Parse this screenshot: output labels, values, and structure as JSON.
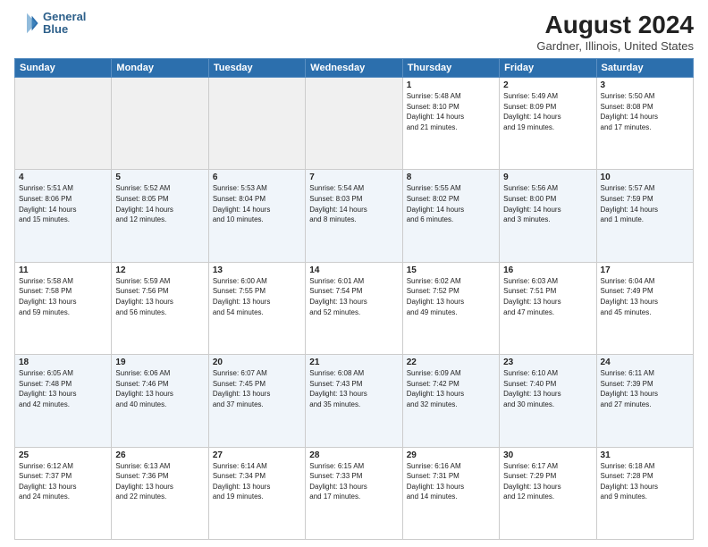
{
  "logo": {
    "line1": "General",
    "line2": "Blue"
  },
  "title": "August 2024",
  "subtitle": "Gardner, Illinois, United States",
  "days_of_week": [
    "Sunday",
    "Monday",
    "Tuesday",
    "Wednesday",
    "Thursday",
    "Friday",
    "Saturday"
  ],
  "weeks": [
    [
      {
        "day": "",
        "info": ""
      },
      {
        "day": "",
        "info": ""
      },
      {
        "day": "",
        "info": ""
      },
      {
        "day": "",
        "info": ""
      },
      {
        "day": "1",
        "info": "Sunrise: 5:48 AM\nSunset: 8:10 PM\nDaylight: 14 hours\nand 21 minutes."
      },
      {
        "day": "2",
        "info": "Sunrise: 5:49 AM\nSunset: 8:09 PM\nDaylight: 14 hours\nand 19 minutes."
      },
      {
        "day": "3",
        "info": "Sunrise: 5:50 AM\nSunset: 8:08 PM\nDaylight: 14 hours\nand 17 minutes."
      }
    ],
    [
      {
        "day": "4",
        "info": "Sunrise: 5:51 AM\nSunset: 8:06 PM\nDaylight: 14 hours\nand 15 minutes."
      },
      {
        "day": "5",
        "info": "Sunrise: 5:52 AM\nSunset: 8:05 PM\nDaylight: 14 hours\nand 12 minutes."
      },
      {
        "day": "6",
        "info": "Sunrise: 5:53 AM\nSunset: 8:04 PM\nDaylight: 14 hours\nand 10 minutes."
      },
      {
        "day": "7",
        "info": "Sunrise: 5:54 AM\nSunset: 8:03 PM\nDaylight: 14 hours\nand 8 minutes."
      },
      {
        "day": "8",
        "info": "Sunrise: 5:55 AM\nSunset: 8:02 PM\nDaylight: 14 hours\nand 6 minutes."
      },
      {
        "day": "9",
        "info": "Sunrise: 5:56 AM\nSunset: 8:00 PM\nDaylight: 14 hours\nand 3 minutes."
      },
      {
        "day": "10",
        "info": "Sunrise: 5:57 AM\nSunset: 7:59 PM\nDaylight: 14 hours\nand 1 minute."
      }
    ],
    [
      {
        "day": "11",
        "info": "Sunrise: 5:58 AM\nSunset: 7:58 PM\nDaylight: 13 hours\nand 59 minutes."
      },
      {
        "day": "12",
        "info": "Sunrise: 5:59 AM\nSunset: 7:56 PM\nDaylight: 13 hours\nand 56 minutes."
      },
      {
        "day": "13",
        "info": "Sunrise: 6:00 AM\nSunset: 7:55 PM\nDaylight: 13 hours\nand 54 minutes."
      },
      {
        "day": "14",
        "info": "Sunrise: 6:01 AM\nSunset: 7:54 PM\nDaylight: 13 hours\nand 52 minutes."
      },
      {
        "day": "15",
        "info": "Sunrise: 6:02 AM\nSunset: 7:52 PM\nDaylight: 13 hours\nand 49 minutes."
      },
      {
        "day": "16",
        "info": "Sunrise: 6:03 AM\nSunset: 7:51 PM\nDaylight: 13 hours\nand 47 minutes."
      },
      {
        "day": "17",
        "info": "Sunrise: 6:04 AM\nSunset: 7:49 PM\nDaylight: 13 hours\nand 45 minutes."
      }
    ],
    [
      {
        "day": "18",
        "info": "Sunrise: 6:05 AM\nSunset: 7:48 PM\nDaylight: 13 hours\nand 42 minutes."
      },
      {
        "day": "19",
        "info": "Sunrise: 6:06 AM\nSunset: 7:46 PM\nDaylight: 13 hours\nand 40 minutes."
      },
      {
        "day": "20",
        "info": "Sunrise: 6:07 AM\nSunset: 7:45 PM\nDaylight: 13 hours\nand 37 minutes."
      },
      {
        "day": "21",
        "info": "Sunrise: 6:08 AM\nSunset: 7:43 PM\nDaylight: 13 hours\nand 35 minutes."
      },
      {
        "day": "22",
        "info": "Sunrise: 6:09 AM\nSunset: 7:42 PM\nDaylight: 13 hours\nand 32 minutes."
      },
      {
        "day": "23",
        "info": "Sunrise: 6:10 AM\nSunset: 7:40 PM\nDaylight: 13 hours\nand 30 minutes."
      },
      {
        "day": "24",
        "info": "Sunrise: 6:11 AM\nSunset: 7:39 PM\nDaylight: 13 hours\nand 27 minutes."
      }
    ],
    [
      {
        "day": "25",
        "info": "Sunrise: 6:12 AM\nSunset: 7:37 PM\nDaylight: 13 hours\nand 24 minutes."
      },
      {
        "day": "26",
        "info": "Sunrise: 6:13 AM\nSunset: 7:36 PM\nDaylight: 13 hours\nand 22 minutes."
      },
      {
        "day": "27",
        "info": "Sunrise: 6:14 AM\nSunset: 7:34 PM\nDaylight: 13 hours\nand 19 minutes."
      },
      {
        "day": "28",
        "info": "Sunrise: 6:15 AM\nSunset: 7:33 PM\nDaylight: 13 hours\nand 17 minutes."
      },
      {
        "day": "29",
        "info": "Sunrise: 6:16 AM\nSunset: 7:31 PM\nDaylight: 13 hours\nand 14 minutes."
      },
      {
        "day": "30",
        "info": "Sunrise: 6:17 AM\nSunset: 7:29 PM\nDaylight: 13 hours\nand 12 minutes."
      },
      {
        "day": "31",
        "info": "Sunrise: 6:18 AM\nSunset: 7:28 PM\nDaylight: 13 hours\nand 9 minutes."
      }
    ]
  ]
}
